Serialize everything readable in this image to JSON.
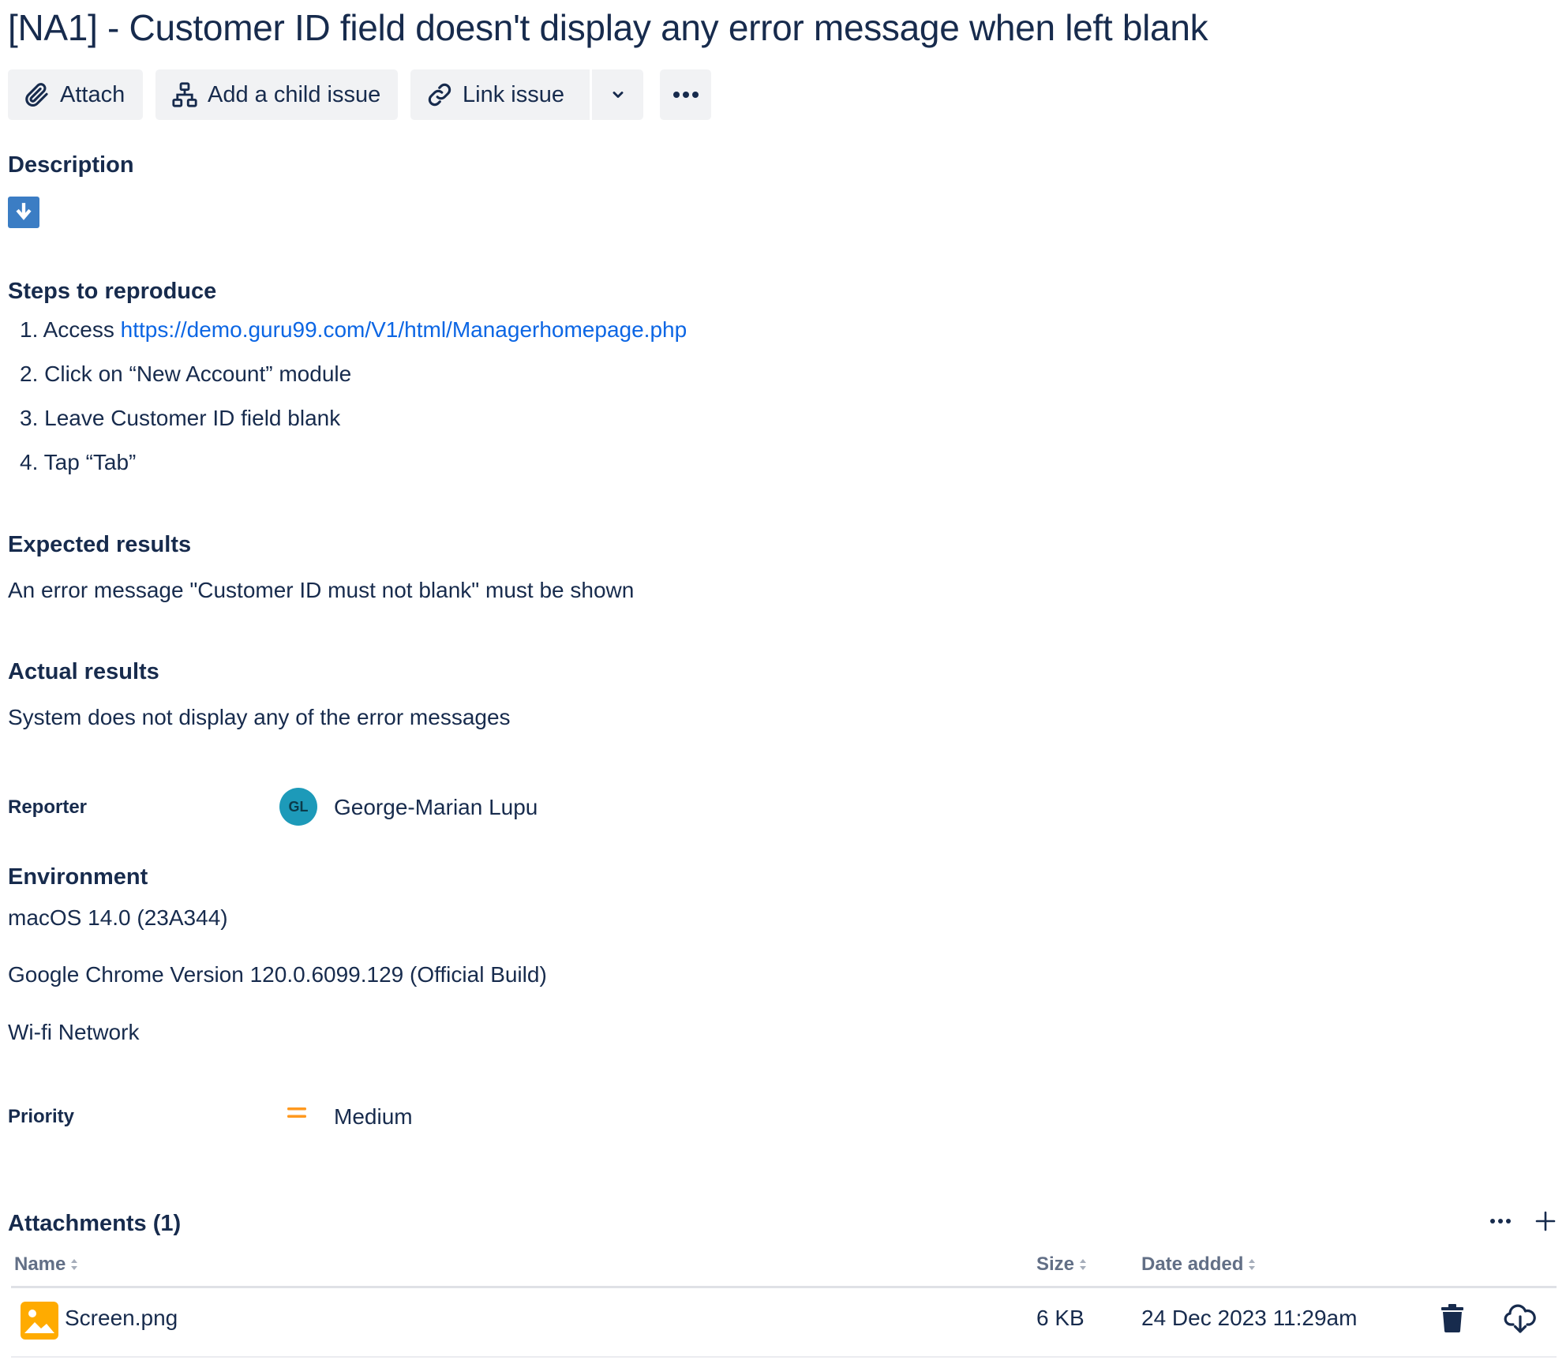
{
  "issue": {
    "title": "[NA1] - Customer ID field doesn't display any error message when left blank"
  },
  "toolbar": {
    "attach_label": "Attach",
    "child_issue_label": "Add a child issue",
    "link_issue_label": "Link issue"
  },
  "description": {
    "heading": "Description",
    "steps_heading": "Steps to reproduce",
    "steps": [
      {
        "number": "1.",
        "text": "Access ",
        "link": "https://demo.guru99.com/V1/html/Managerhomepage.php"
      },
      {
        "number": "2.",
        "text": "Click on “New Account” module"
      },
      {
        "number": "3.",
        "text": "Leave Customer ID field blank"
      },
      {
        "number": "4.",
        "text": "Tap “Tab”"
      }
    ],
    "expected_heading": "Expected results",
    "expected_text": "An error message \"Customer ID must not blank\" must be shown",
    "actual_heading": "Actual results",
    "actual_text": "System does not display any of the error messages"
  },
  "reporter": {
    "label": "Reporter",
    "initials": "GL",
    "name": "George-Marian Lupu"
  },
  "environment": {
    "heading": "Environment",
    "lines": [
      "macOS 14.0 (23A344)",
      "Google Chrome Version 120.0.6099.129 (Official Build)",
      "Wi-fi Network"
    ]
  },
  "priority": {
    "label": "Priority",
    "value": "Medium",
    "icon": "priority-medium-icon",
    "color": "#ff991f"
  },
  "attachments": {
    "heading": "Attachments (1)",
    "columns": {
      "name": "Name",
      "size": "Size",
      "date": "Date added"
    },
    "rows": [
      {
        "name": "Screen.png",
        "size": "6 KB",
        "date": "24 Dec 2023 11:29am"
      }
    ]
  },
  "colors": {
    "text": "#172b4d",
    "link": "#0c66e4",
    "button_bg": "#f1f2f4",
    "expand_icon_bg": "#3b7dc4",
    "avatar_bg": "#1d9ab9",
    "file_icon": "#ffab00"
  }
}
